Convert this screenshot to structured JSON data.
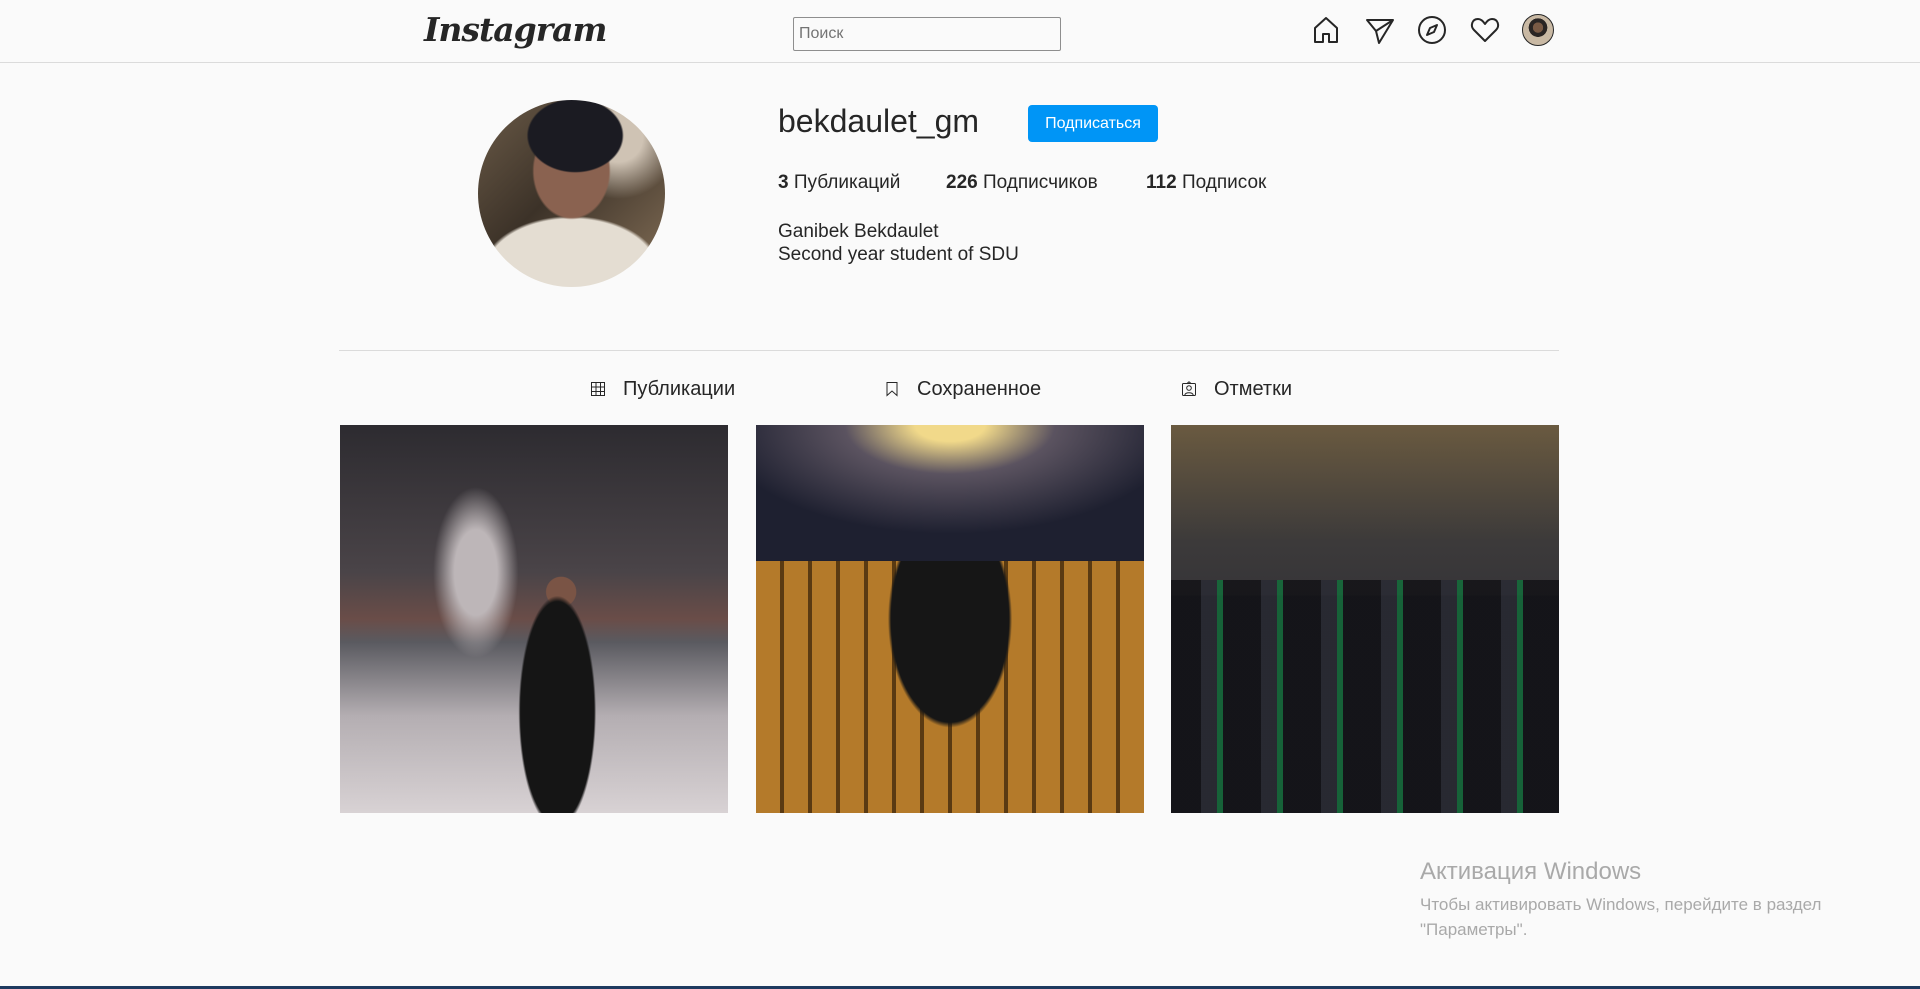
{
  "header": {
    "logo": "Instagram",
    "search_placeholder": "Поиск",
    "nav_icons": [
      "home-icon",
      "direct-icon",
      "explore-icon",
      "heart-icon"
    ]
  },
  "profile": {
    "username": "bekdaulet_gm",
    "follow_label": "Подписаться",
    "stats": [
      {
        "count": "3",
        "label": "Публикаций"
      },
      {
        "count": "226",
        "label": "Подписчиков"
      },
      {
        "count": "112",
        "label": "Подписок"
      }
    ],
    "full_name": "Ganibek Bekdaulet",
    "bio": "Second year student of SDU"
  },
  "tabs": [
    {
      "label": "Публикации",
      "icon": "grid-icon"
    },
    {
      "label": "Сохраненное",
      "icon": "bookmark-icon"
    },
    {
      "label": "Отметки",
      "icon": "tagged-icon"
    }
  ],
  "posts": [
    {
      "name": "post-1"
    },
    {
      "name": "post-2"
    },
    {
      "name": "post-3"
    }
  ],
  "windows_activation": {
    "title": "Активация Windows",
    "message": "Чтобы активировать Windows, перейдите в раздел \"Параметры\"."
  }
}
